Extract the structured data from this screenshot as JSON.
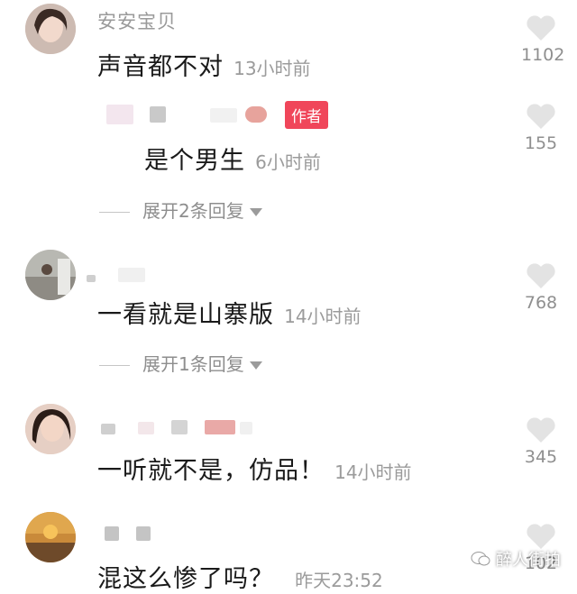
{
  "comments": [
    {
      "username": "安安宝贝",
      "text": "声音都不对",
      "time": "13小时前",
      "likes": "1102",
      "expand": ""
    },
    {
      "author_badge": "作者",
      "text": "是个男生",
      "time": "6小时前",
      "likes": "155",
      "expand": "展开2条回复"
    },
    {
      "text": "一看就是山寨版",
      "time": "14小时前",
      "likes": "768",
      "expand": "展开1条回复"
    },
    {
      "text": "一听就不是，仿品！",
      "time": "14小时前",
      "likes": "345"
    },
    {
      "text": "混这么惨了吗？",
      "time": "昨天23:52",
      "likes": "102"
    }
  ],
  "watermark": "醉人街拍",
  "colors": {
    "badge": "#f0465a",
    "heart": "#e3e3e3"
  }
}
